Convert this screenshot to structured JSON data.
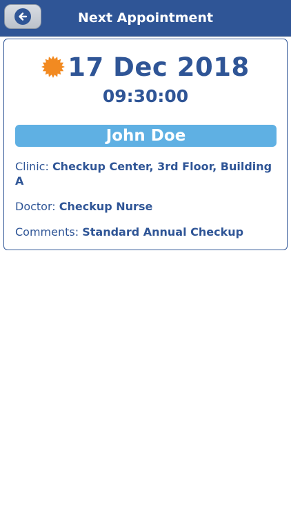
{
  "header": {
    "title": "Next Appointment",
    "back_icon": "arrow-left-circle-icon"
  },
  "appointment": {
    "date": "17 Dec 2018",
    "time": "09:30:00",
    "status_icon": "orange-starburst-icon",
    "patient_name": "John Doe",
    "clinic_label": "Clinic:",
    "clinic_value": "Checkup Center, 3rd Floor, Building A",
    "doctor_label": "Doctor:",
    "doctor_value": "Checkup Nurse",
    "comments_label": "Comments:",
    "comments_value": "Standard Annual Checkup"
  },
  "colors": {
    "header_bg": "#2f5596",
    "primary_text": "#2f5596",
    "patient_bar": "#5fb0e3",
    "badge": "#f28a21"
  }
}
